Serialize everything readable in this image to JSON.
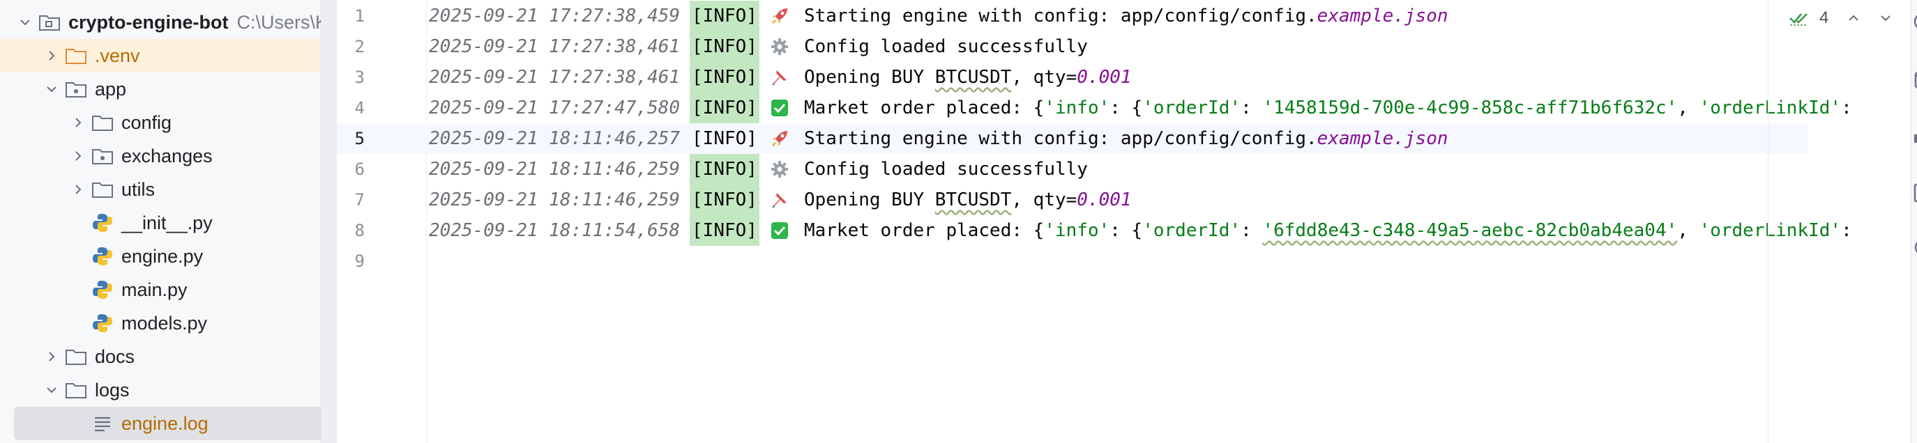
{
  "project_tree": {
    "root": {
      "name": "crypto-engine-bot",
      "path": "C:\\Users\\K"
    },
    "items": [
      {
        "label": ".venv"
      },
      {
        "label": "app"
      },
      {
        "label": "config"
      },
      {
        "label": "exchanges"
      },
      {
        "label": "utils"
      },
      {
        "label": "__init__.py"
      },
      {
        "label": "engine.py"
      },
      {
        "label": "main.py"
      },
      {
        "label": "models.py"
      },
      {
        "label": "docs"
      },
      {
        "label": "logs"
      },
      {
        "label": "engine.log"
      }
    ]
  },
  "editor": {
    "current_line": 5,
    "lines": [
      {
        "num": "1",
        "ts": "2025-09-21 17:27:38,459",
        "level": "[INFO]",
        "icon": "rocket-icon",
        "text": "Starting engine with config: app/config/config.",
        "italic": "example.json"
      },
      {
        "num": "2",
        "ts": "2025-09-21 17:27:38,461",
        "level": "[INFO]",
        "icon": "gear-icon",
        "text": "Config loaded successfully"
      },
      {
        "num": "3",
        "ts": "2025-09-21 17:27:38,461",
        "level": "[INFO]",
        "icon": "pushpin-icon",
        "text": "Opening BUY ",
        "wavy": "BTCUSDT",
        "text2": ", qty=",
        "italic": "0.001"
      },
      {
        "num": "4",
        "ts": "2025-09-21 17:27:47,580",
        "level": "[INFO]",
        "icon": "check-icon",
        "text": "Market order placed: {",
        "s1": "'info'",
        "t1": ": {",
        "s2": "'orderId'",
        "t2": ": ",
        "s3": "'1458159d-700e-4c99-858c-aff71b6f632c'",
        "t3": ", ",
        "s4": "'orderLinkId'",
        "t4": ":"
      },
      {
        "num": "5",
        "ts": "2025-09-21 18:11:46,257",
        "level": "[INFO]",
        "icon": "rocket-icon",
        "text": "Starting engine with config: app/config/config.",
        "italic": "example.json"
      },
      {
        "num": "6",
        "ts": "2025-09-21 18:11:46,259",
        "level": "[INFO]",
        "icon": "gear-icon",
        "text": "Config loaded successfully"
      },
      {
        "num": "7",
        "ts": "2025-09-21 18:11:46,259",
        "level": "[INFO]",
        "icon": "pushpin-icon",
        "text": "Opening BUY ",
        "wavy": "BTCUSDT",
        "text2": ", qty=",
        "italic": "0.001"
      },
      {
        "num": "8",
        "ts": "2025-09-21 18:11:54,658",
        "level": "[INFO]",
        "icon": "check-icon",
        "text": "Market order placed: {",
        "s1": "'info'",
        "t1": ": {",
        "s2": "'orderId'",
        "t2": ": ",
        "s3": "'6fdd8e43-c348-49a5-aebc-82cb0ab4ea04'",
        "t3": ", ",
        "s4": "'orderLinkId'",
        "t4": ":"
      },
      {
        "num": "9"
      }
    ]
  },
  "inspections": {
    "count": "4",
    "icon": "double-check-icon"
  },
  "colors": {
    "info_highlight": "#c3e8c1",
    "string": "#067d17",
    "italic_value": "#871094",
    "selection": "#dfe1e5",
    "excluded_folder": "#fdf1dc"
  }
}
